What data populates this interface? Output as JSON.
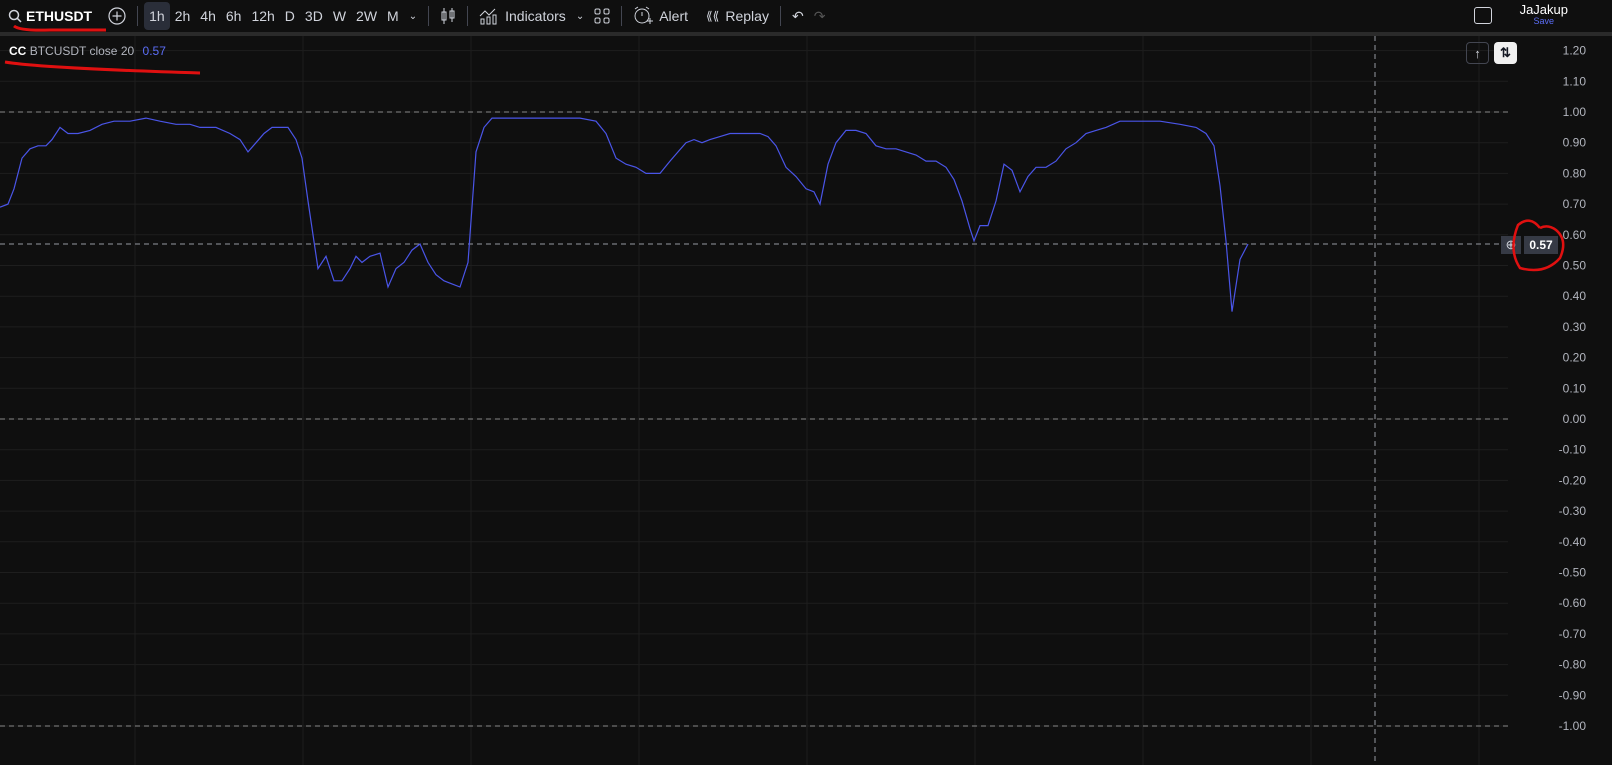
{
  "toolbar": {
    "symbol": "ETHUSDT",
    "intervals": [
      "1h",
      "2h",
      "4h",
      "6h",
      "12h",
      "D",
      "3D",
      "W",
      "2W",
      "M"
    ],
    "active_interval": "1h",
    "indicators_label": "Indicators",
    "alert_label": "Alert",
    "replay_label": "Replay",
    "user_name": "JaJakup",
    "save_label": "Save"
  },
  "legend": {
    "name": "CC",
    "params": "BTCUSDT close 20",
    "value": "0.57"
  },
  "colors": {
    "line": "#4a55e8",
    "accent": "#5b6df5",
    "annotation": "#e01010"
  },
  "price_tag": "0.57",
  "chart_data": {
    "type": "line",
    "title": "CC BTCUSDT close 20",
    "ylim": [
      -1.0,
      1.24
    ],
    "y_ticks": [
      "1.20",
      "1.10",
      "1.00",
      "0.90",
      "0.80",
      "0.70",
      "0.60",
      "0.50",
      "0.40",
      "0.30",
      "0.20",
      "0.10",
      "0.00",
      "-0.10",
      "-0.20",
      "-0.30",
      "-0.40",
      "-0.50",
      "-0.60",
      "-0.70",
      "-0.80",
      "-0.90",
      "-1.00"
    ],
    "hlines": [
      1.0,
      0.0,
      -1.0
    ],
    "crosshair_value": 0.57,
    "x_range": [
      0,
      754
    ],
    "series": [
      {
        "name": "CC",
        "points": [
          [
            0,
            0.69
          ],
          [
            4,
            0.7
          ],
          [
            7,
            0.75
          ],
          [
            11,
            0.85
          ],
          [
            15,
            0.88
          ],
          [
            19,
            0.89
          ],
          [
            23,
            0.89
          ],
          [
            26,
            0.91
          ],
          [
            30,
            0.95
          ],
          [
            34,
            0.93
          ],
          [
            39,
            0.93
          ],
          [
            45,
            0.94
          ],
          [
            51,
            0.96
          ],
          [
            57,
            0.97
          ],
          [
            65,
            0.97
          ],
          [
            73,
            0.98
          ],
          [
            80,
            0.97
          ],
          [
            88,
            0.96
          ],
          [
            95,
            0.96
          ],
          [
            100,
            0.95
          ],
          [
            108,
            0.95
          ],
          [
            115,
            0.93
          ],
          [
            120,
            0.91
          ],
          [
            124,
            0.87
          ],
          [
            128,
            0.9
          ],
          [
            132,
            0.93
          ],
          [
            136,
            0.95
          ],
          [
            140,
            0.95
          ],
          [
            144,
            0.95
          ],
          [
            148,
            0.91
          ],
          [
            151,
            0.85
          ],
          [
            154,
            0.71
          ],
          [
            159,
            0.49
          ],
          [
            163,
            0.53
          ],
          [
            167,
            0.45
          ],
          [
            171,
            0.45
          ],
          [
            175,
            0.49
          ],
          [
            178,
            0.53
          ],
          [
            181,
            0.51
          ],
          [
            185,
            0.53
          ],
          [
            190,
            0.54
          ],
          [
            194,
            0.43
          ],
          [
            198,
            0.49
          ],
          [
            202,
            0.51
          ],
          [
            206,
            0.55
          ],
          [
            210,
            0.57
          ],
          [
            214,
            0.51
          ],
          [
            218,
            0.47
          ],
          [
            222,
            0.45
          ],
          [
            226,
            0.44
          ],
          [
            230,
            0.43
          ],
          [
            234,
            0.51
          ],
          [
            238,
            0.87
          ],
          [
            242,
            0.95
          ],
          [
            246,
            0.98
          ],
          [
            250,
            0.98
          ],
          [
            260,
            0.98
          ],
          [
            270,
            0.98
          ],
          [
            280,
            0.98
          ],
          [
            290,
            0.98
          ],
          [
            298,
            0.97
          ],
          [
            303,
            0.93
          ],
          [
            308,
            0.85
          ],
          [
            313,
            0.83
          ],
          [
            318,
            0.82
          ],
          [
            323,
            0.8
          ],
          [
            325,
            0.8
          ],
          [
            330,
            0.8
          ],
          [
            335,
            0.84
          ],
          [
            339,
            0.87
          ],
          [
            343,
            0.9
          ],
          [
            347,
            0.91
          ],
          [
            351,
            0.9
          ],
          [
            355,
            0.91
          ],
          [
            360,
            0.92
          ],
          [
            365,
            0.93
          ],
          [
            370,
            0.93
          ],
          [
            375,
            0.93
          ],
          [
            380,
            0.93
          ],
          [
            384,
            0.92
          ],
          [
            388,
            0.89
          ],
          [
            393,
            0.82
          ],
          [
            398,
            0.79
          ],
          [
            403,
            0.75
          ],
          [
            407,
            0.74
          ],
          [
            410,
            0.7
          ],
          [
            414,
            0.83
          ],
          [
            418,
            0.9
          ],
          [
            423,
            0.94
          ],
          [
            428,
            0.94
          ],
          [
            433,
            0.93
          ],
          [
            438,
            0.89
          ],
          [
            443,
            0.88
          ],
          [
            448,
            0.88
          ],
          [
            453,
            0.87
          ],
          [
            458,
            0.86
          ],
          [
            463,
            0.84
          ],
          [
            468,
            0.84
          ],
          [
            473,
            0.82
          ],
          [
            477,
            0.78
          ],
          [
            481,
            0.71
          ],
          [
            485,
            0.62
          ],
          [
            487,
            0.58
          ],
          [
            490,
            0.63
          ],
          [
            494,
            0.63
          ],
          [
            498,
            0.71
          ],
          [
            502,
            0.83
          ],
          [
            506,
            0.81
          ],
          [
            510,
            0.74
          ],
          [
            514,
            0.79
          ],
          [
            518,
            0.82
          ],
          [
            523,
            0.82
          ],
          [
            528,
            0.84
          ],
          [
            533,
            0.88
          ],
          [
            538,
            0.9
          ],
          [
            543,
            0.93
          ],
          [
            548,
            0.94
          ],
          [
            553,
            0.95
          ],
          [
            560,
            0.97
          ],
          [
            570,
            0.97
          ],
          [
            580,
            0.97
          ],
          [
            590,
            0.96
          ],
          [
            598,
            0.95
          ],
          [
            603,
            0.93
          ],
          [
            607,
            0.89
          ],
          [
            610,
            0.76
          ],
          [
            613,
            0.58
          ],
          [
            616,
            0.35
          ],
          [
            620,
            0.52
          ],
          [
            624,
            0.57
          ]
        ]
      }
    ]
  }
}
